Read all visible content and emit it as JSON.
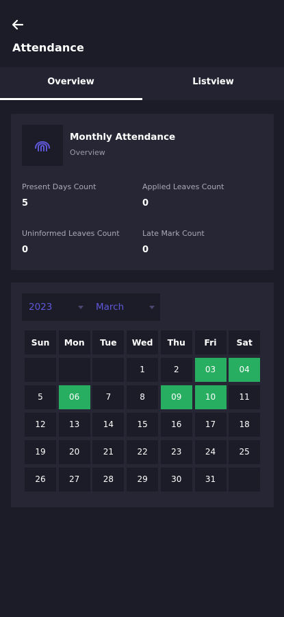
{
  "header": {
    "title": "Attendance",
    "back_icon": "arrow-left-icon"
  },
  "tabs": [
    {
      "label": "Overview",
      "active": true
    },
    {
      "label": "Listview",
      "active": false
    }
  ],
  "summary": {
    "title": "Monthly Attendance",
    "subtitle": "Overview",
    "icon": "fingerprint-icon",
    "stats": [
      {
        "label": "Present Days Count",
        "value": "5"
      },
      {
        "label": "Applied Leaves Count",
        "value": "0"
      },
      {
        "label": "Uninformed Leaves Count",
        "value": "0"
      },
      {
        "label": "Late Mark Count",
        "value": "0"
      }
    ]
  },
  "calendar": {
    "year": "2023",
    "month": "March",
    "weekdays": [
      "Sun",
      "Mon",
      "Tue",
      "Wed",
      "Thu",
      "Fri",
      "Sat"
    ],
    "weeks": [
      [
        "",
        "",
        "",
        "1",
        "2",
        "03",
        "04"
      ],
      [
        "5",
        "06",
        "7",
        "8",
        "09",
        "10",
        "11"
      ],
      [
        "12",
        "13",
        "14",
        "15",
        "16",
        "17",
        "18"
      ],
      [
        "19",
        "20",
        "21",
        "22",
        "23",
        "24",
        "25"
      ],
      [
        "26",
        "27",
        "28",
        "29",
        "30",
        "31",
        ""
      ]
    ],
    "present_days": [
      "03",
      "04",
      "06",
      "09",
      "10"
    ]
  },
  "colors": {
    "background": "#1c1c28",
    "card": "#262635",
    "accent": "#5e58d8",
    "present": "#27ae60"
  }
}
